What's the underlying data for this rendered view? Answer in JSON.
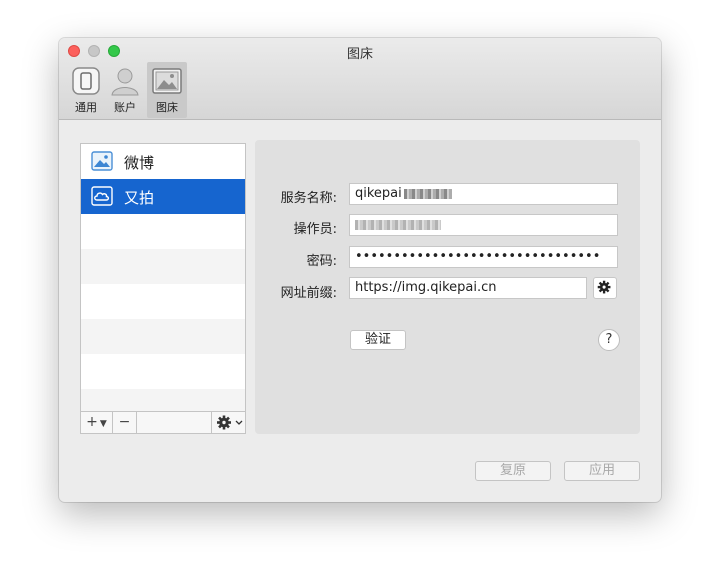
{
  "window": {
    "title": "图床"
  },
  "toolbar": {
    "items": [
      {
        "label": "通用",
        "icon": "general-icon"
      },
      {
        "label": "账户",
        "icon": "account-icon"
      },
      {
        "label": "图床",
        "icon": "image-host-icon"
      }
    ],
    "active": "图床"
  },
  "sidebar": {
    "items": [
      {
        "label": "微博",
        "icon": "image-icon"
      },
      {
        "label": "又拍",
        "icon": "cloud-icon",
        "selected": true
      }
    ],
    "add_label": "+",
    "remove_label": "−"
  },
  "form": {
    "service_name_label": "服务名称:",
    "service_name_value": "qikepai",
    "operator_label": "操作员:",
    "password_label": "密码:",
    "password_value": "••••••••••••••••••••••••••••••••",
    "url_prefix_label": "网址前缀:",
    "url_prefix_value": "https://img.qikepai.cn",
    "verify_label": "验证",
    "help_label": "?"
  },
  "footer": {
    "restore_label": "复原",
    "apply_label": "应用"
  },
  "colors": {
    "selection": "#1665cf",
    "close": "#fc605c",
    "maximize": "#34c84a"
  }
}
